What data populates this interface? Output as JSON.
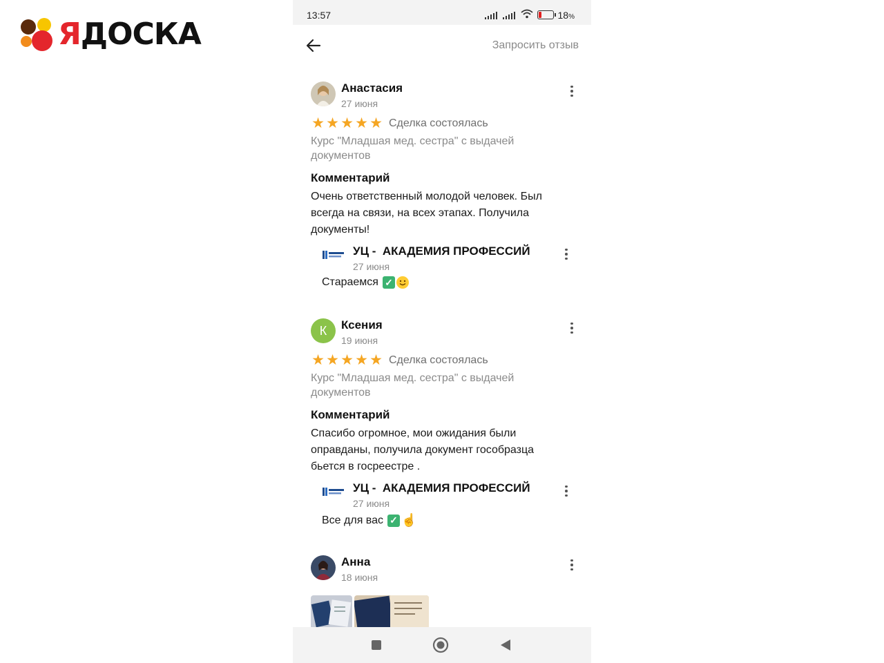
{
  "brand": {
    "ya": "Я",
    "rest": "ДОСКА"
  },
  "status": {
    "time": "13:57",
    "battery": "18",
    "battery_unit": "%"
  },
  "header": {
    "request_review": "Запросить отзыв"
  },
  "colors": {
    "accent_star": "#f5a623",
    "battery_low": "#e02020",
    "avatar_green": "#8bc34a"
  },
  "reviews": [
    {
      "name": "Анастасия",
      "date": "27 июня",
      "rating": 5,
      "deal": "Сделка состоялась",
      "item": "Курс \"Младшая мед. сестра\" с выдачей документов",
      "comment_heading": "Комментарий",
      "comment": "Очень ответственный молодой человек. Был всегда на связи, на всех этапах. Получила документы!",
      "reply": {
        "seller": "УЦ -  АКАДЕМИЯ ПРОФЕССИЙ",
        "date": "27 июня",
        "text": "Стараемся"
      }
    },
    {
      "name": "Ксения",
      "initial": "К",
      "date": "19 июня",
      "rating": 5,
      "deal": "Сделка состоялась",
      "item": "Курс \"Младшая мед. сестра\" с выдачей документов",
      "comment_heading": "Комментарий",
      "comment": "Спасибо огромное, мои ожидания были оправданы, получила документ гособразца бьется в госреестре .",
      "reply": {
        "seller": "УЦ -  АКАДЕМИЯ ПРОФЕССИЙ",
        "date": "27 июня",
        "text": "Все для вас"
      }
    },
    {
      "name": "Анна",
      "date": "18 июня"
    }
  ],
  "icons": [
    "back-arrow-icon",
    "more-vert-icon",
    "star-icon",
    "check-mark-icon",
    "smile-icon",
    "pointing-finger-icon",
    "nav-recents-icon",
    "nav-home-icon",
    "nav-back-icon"
  ]
}
